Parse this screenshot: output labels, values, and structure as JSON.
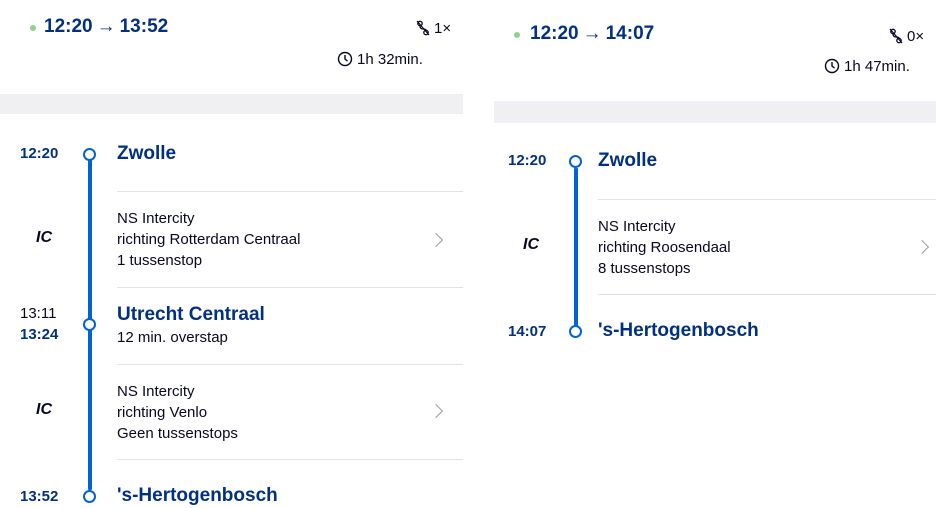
{
  "left": {
    "summary": {
      "departure": "12:20",
      "arrival": "13:52",
      "transfers": "1×",
      "duration": "1h 32min."
    },
    "stops": [
      {
        "time": "12:20",
        "name": "Zwolle"
      },
      {
        "time_arrival": "13:11",
        "time_departure": "13:24",
        "name": "Utrecht Centraal",
        "note": "12 min. overstap"
      },
      {
        "time": "13:52",
        "name": "'s-Hertogenbosch"
      }
    ],
    "legs": [
      {
        "type": "IC",
        "train": "NS Intercity",
        "direction": "richting Rotterdam Centraal",
        "stops": "1 tussenstop"
      },
      {
        "type": "IC",
        "train": "NS Intercity",
        "direction": "richting Venlo",
        "stops": "Geen tussenstops"
      }
    ]
  },
  "right": {
    "summary": {
      "departure": "12:20",
      "arrival": "14:07",
      "transfers": "0×",
      "duration": "1h 47min."
    },
    "stops": [
      {
        "time": "12:20",
        "name": "Zwolle"
      },
      {
        "time": "14:07",
        "name": "'s-Hertogenbosch"
      }
    ],
    "legs": [
      {
        "type": "IC",
        "train": "NS Intercity",
        "direction": "richting Roosendaal",
        "stops": "8 tussenstops"
      }
    ]
  },
  "colors": {
    "primary": "#003082",
    "rail": "#0063d3",
    "dot": "#8fd28b",
    "separator": "#e2e2e6",
    "graybar": "#f0f0f2"
  },
  "icons": {
    "transfers": "transfer-icon",
    "duration": "clock-icon",
    "chevron": "chevron-right-icon",
    "stop": "station-node-icon"
  }
}
